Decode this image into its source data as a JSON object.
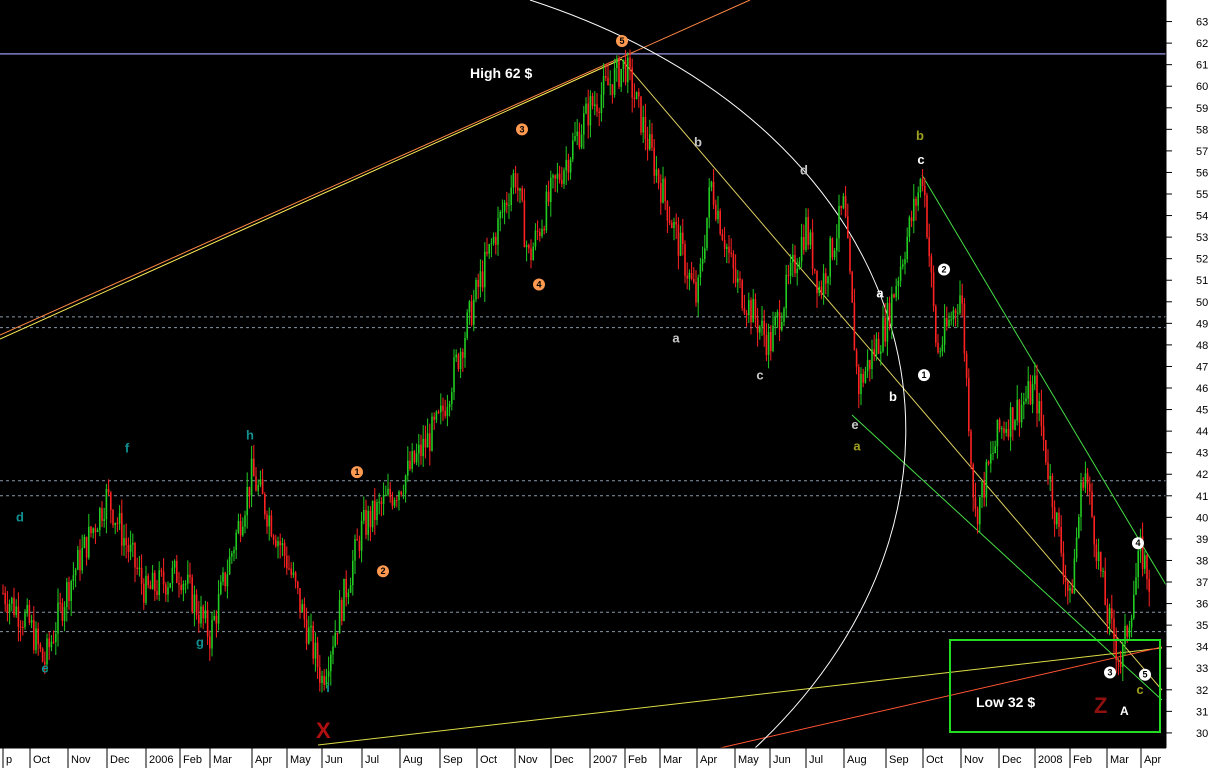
{
  "chart_data": {
    "type": "candlestick",
    "ylim": [
      29.3,
      64
    ],
    "y_ticks": [
      30,
      31,
      32,
      33,
      34,
      35,
      36,
      37,
      38,
      39,
      40,
      41,
      42,
      43,
      44,
      45,
      46,
      47,
      48,
      49,
      50,
      51,
      52,
      53,
      54,
      55,
      56,
      57,
      58,
      59,
      60,
      61,
      62,
      63
    ],
    "x_tick_labels": [
      "p",
      "Oct",
      "Nov",
      "Dec",
      "2006",
      "Feb",
      "Mar",
      "Apr",
      "May",
      "Jun",
      "Jul",
      "Aug",
      "Sep",
      "Oct",
      "Nov",
      "Dec",
      "2007",
      "Feb",
      "Mar",
      "Apr",
      "May",
      "Jun",
      "Jul",
      "Aug",
      "Sep",
      "Oct",
      "Nov",
      "Dec",
      "2008",
      "Feb",
      "Mar",
      "Apr"
    ],
    "colors": {
      "background": "#000000",
      "up": "#22cc22",
      "down": "#ff2222",
      "axis_bg": "#ffffff",
      "grid": "#8899aa",
      "resistance": "#8080c0"
    },
    "price_path": [
      [
        "p",
        36.5
      ],
      [
        "Oct",
        35.0
      ],
      [
        "Oct",
        33.2
      ],
      [
        "Nov",
        36.8
      ],
      [
        "Dec",
        41.0
      ],
      [
        "2006",
        36.5
      ],
      [
        "Feb",
        37.5
      ],
      [
        "Mar",
        34.5
      ],
      [
        "Apr",
        42.0
      ],
      [
        "May",
        38.0
      ],
      [
        "Jun",
        32.5
      ],
      [
        "Jul",
        39.5
      ],
      [
        "Aug",
        41.5
      ],
      [
        "Sep",
        44.5
      ],
      [
        "Oct",
        50.5
      ],
      [
        "Nov",
        56.0
      ],
      [
        "Nov",
        52.0
      ],
      [
        "Dec",
        55.0
      ],
      [
        "2007",
        59.0
      ],
      [
        "Feb",
        61.0
      ],
      [
        "Mar",
        55.5
      ],
      [
        "Apr",
        50.0
      ],
      [
        "Apr",
        55.5
      ],
      [
        "May",
        51.0
      ],
      [
        "Jun",
        48.0
      ],
      [
        "Jul",
        53.5
      ],
      [
        "Jul",
        50.5
      ],
      [
        "Aug",
        54.5
      ],
      [
        "Aug",
        46.0
      ],
      [
        "Sep",
        49.0
      ],
      [
        "Oct",
        56.0
      ],
      [
        "Oct",
        47.5
      ],
      [
        "Nov",
        50.5
      ],
      [
        "Nov",
        40.0
      ],
      [
        "Dec",
        44.0
      ],
      [
        "2008",
        46.0
      ],
      [
        "Feb",
        36.0
      ],
      [
        "Feb",
        42.5
      ],
      [
        "Mar",
        35.5
      ],
      [
        "Mar",
        33.2
      ],
      [
        "Apr",
        38.5
      ],
      [
        "Apr",
        36.0
      ]
    ],
    "h_lines": [
      61.5,
      49.3,
      48.8,
      41.7,
      41.0,
      35.6,
      34.7
    ],
    "annotations": {
      "high": "High 62 $",
      "low": "Low 32 $",
      "x_label": "X",
      "z_label": "Z",
      "a_label": "A"
    },
    "wave_labels": [
      {
        "text": "d",
        "x": "Oct",
        "y": 39.8,
        "color": "#109090"
      },
      {
        "text": "e",
        "x": "Oct",
        "y": 32.8,
        "color": "#109090"
      },
      {
        "text": "f",
        "x": "Dec",
        "y": 43.0,
        "color": "#109090"
      },
      {
        "text": "g",
        "x": "Mar",
        "y": 34.0,
        "color": "#109090"
      },
      {
        "text": "h",
        "x": "Apr",
        "y": 43.6,
        "color": "#109090"
      },
      {
        "text": "i",
        "x": "Jun",
        "y": 31.9,
        "color": "#109090"
      },
      {
        "text": "a",
        "x": "Apr",
        "y": 48.1,
        "color": "#c8c8c8"
      },
      {
        "text": "b",
        "x": "Apr",
        "y": 57.2,
        "color": "#c8c8c8"
      },
      {
        "text": "c",
        "x": "Jun",
        "y": 46.4,
        "color": "#c8c8c8"
      },
      {
        "text": "d",
        "x": "Jul",
        "y": 55.9,
        "color": "#c8c8c8"
      },
      {
        "text": "e",
        "x": "Aug",
        "y": 44.1,
        "color": "#c8c8c8"
      },
      {
        "text": "a",
        "x": "Aug",
        "y": 43.1,
        "color": "#a0a020"
      },
      {
        "text": "b",
        "x": "Oct",
        "y": 57.5,
        "color": "#a0a020"
      },
      {
        "text": "c",
        "x": "Apr",
        "y": 31.8,
        "color": "#a0a020"
      },
      {
        "text": "a",
        "x": "Sep",
        "y": 50.2,
        "color": "#ffffff"
      },
      {
        "text": "b",
        "x": "Sep",
        "y": 45.4,
        "color": "#ffffff"
      },
      {
        "text": "c",
        "x": "Oct",
        "y": 56.4,
        "color": "#ffffff"
      }
    ],
    "circle_labels": [
      {
        "text": "5",
        "x": "Feb",
        "y": 62.1,
        "color": "#ff9a50"
      },
      {
        "text": "3",
        "x": "Nov",
        "y": 58.0,
        "color": "#ff9a50"
      },
      {
        "text": "4",
        "x": "Nov",
        "y": 50.8,
        "color": "#ff9a50"
      },
      {
        "text": "1",
        "x": "Jul",
        "y": 42.1,
        "color": "#ff9a50"
      },
      {
        "text": "2",
        "x": "Jul",
        "y": 37.5,
        "color": "#ff9a50"
      },
      {
        "text": "2",
        "x": "Oct",
        "y": 51.5,
        "color": "#ffffff"
      },
      {
        "text": "1",
        "x": "Oct",
        "y": 46.6,
        "color": "#ffffff"
      },
      {
        "text": "4",
        "x": "Apr",
        "y": 38.8,
        "color": "#ffffff"
      },
      {
        "text": "3",
        "x": "Mar",
        "y": 32.8,
        "color": "#ffffff"
      },
      {
        "text": "5",
        "x": "Apr",
        "y": 32.7,
        "color": "#ffffff"
      }
    ]
  }
}
